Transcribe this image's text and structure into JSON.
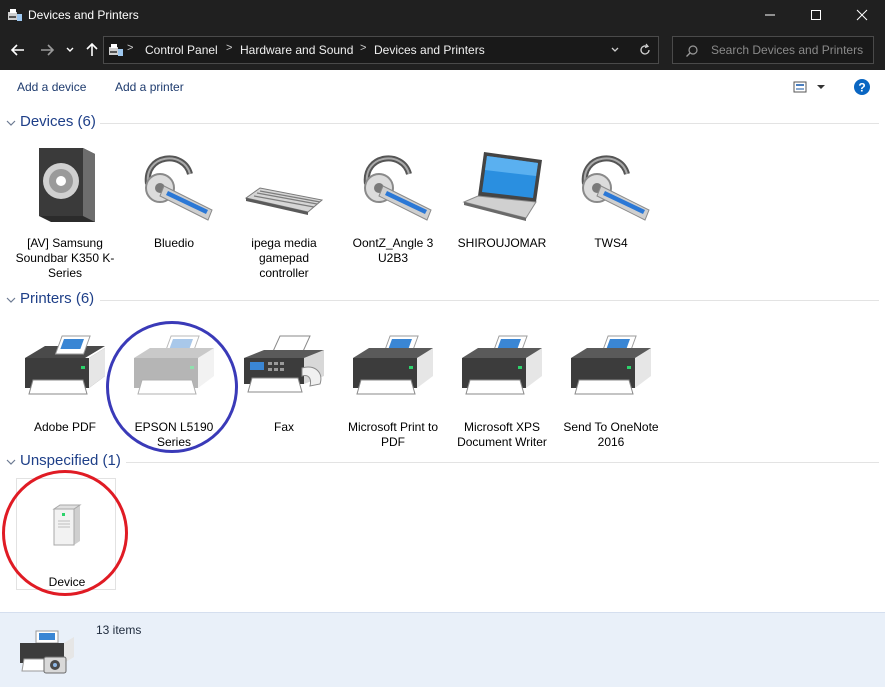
{
  "window": {
    "title": "Devices and Printers"
  },
  "address": {
    "crumbs": [
      "Control Panel",
      "Hardware and Sound",
      "Devices and Printers"
    ]
  },
  "search": {
    "placeholder": "Search Devices and Printers"
  },
  "toolbar": {
    "add_device": "Add a device",
    "add_printer": "Add a printer"
  },
  "groups": {
    "devices": {
      "title": "Devices (6)",
      "items": [
        "[AV] Samsung Soundbar K350 K-Series",
        "Bluedio",
        "ipega media gamepad controller",
        "OontZ_Angle 3 U2B3",
        "SHIROUJOMAR",
        "TWS4"
      ]
    },
    "printers": {
      "title": "Printers (6)",
      "items": [
        "Adobe PDF",
        "EPSON L5190 Series",
        "Fax",
        "Microsoft Print to PDF",
        "Microsoft XPS Document Writer",
        "Send To OneNote 2016"
      ]
    },
    "unspecified": {
      "title": "Unspecified (1)",
      "items": [
        "Device"
      ]
    }
  },
  "status": {
    "count": "13 items"
  },
  "annotation_colors": {
    "blue_circle": "#3a3ab8",
    "red_circle": "#e01b24"
  }
}
